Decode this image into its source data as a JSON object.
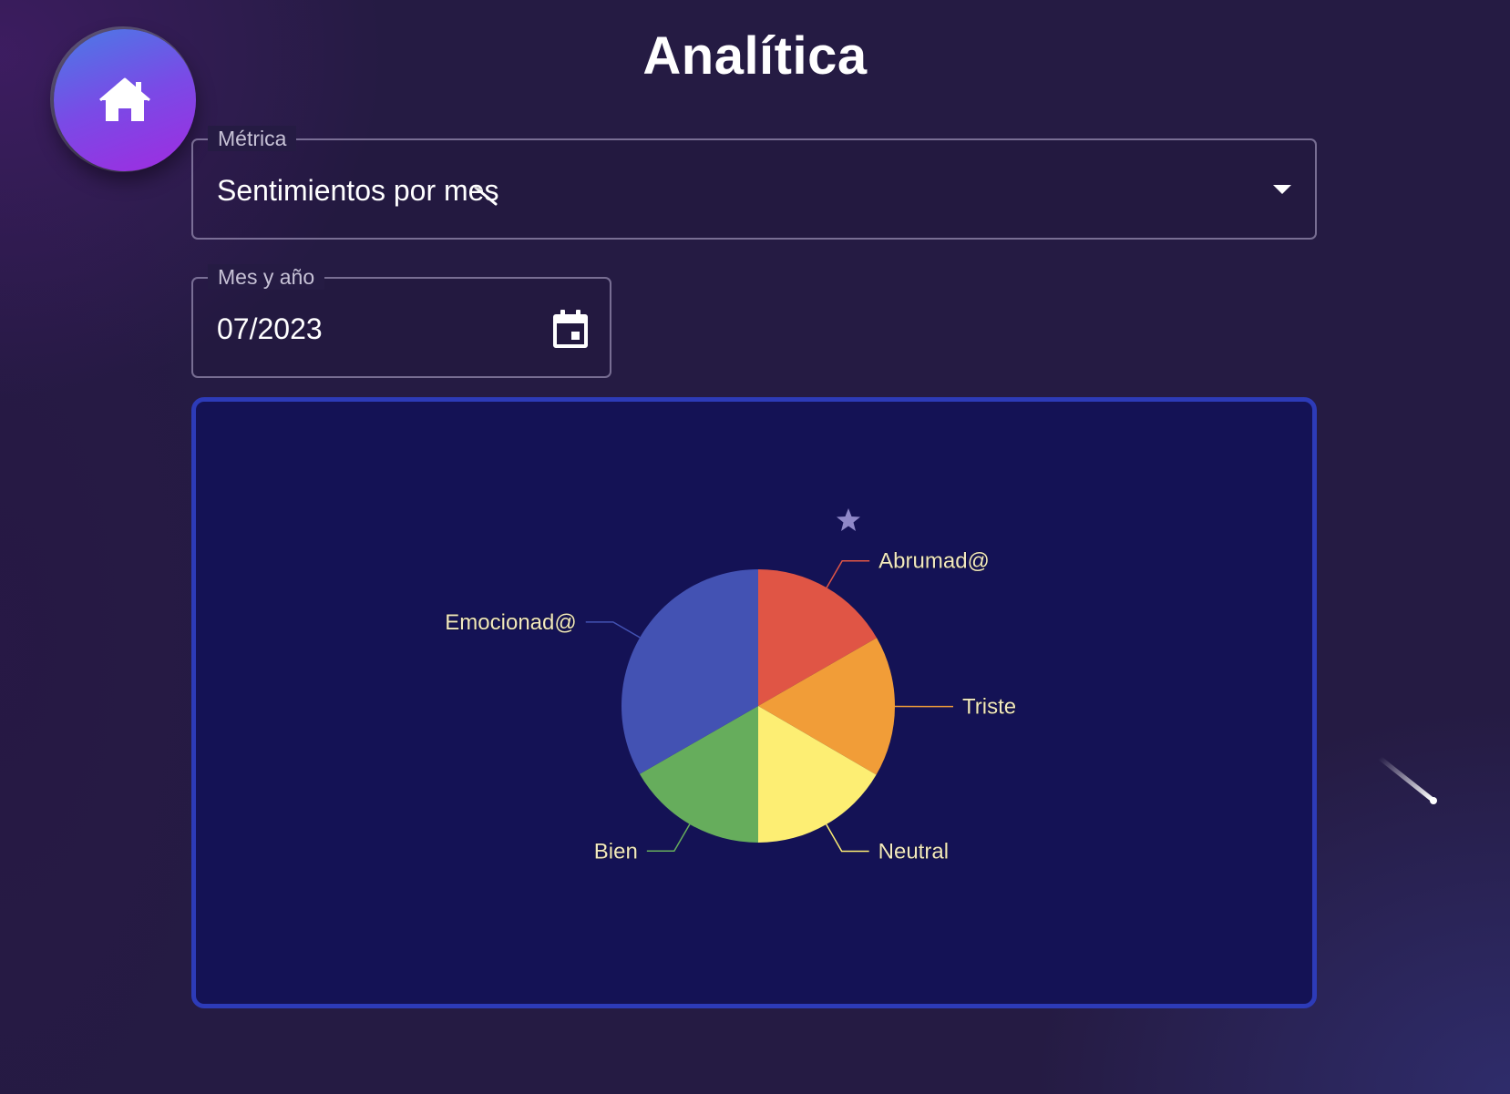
{
  "page": {
    "title": "Analítica"
  },
  "home_button": {
    "icon": "home-icon"
  },
  "metric_select": {
    "label": "Métrica",
    "value": "Sentimientos por mes",
    "icon": "chevron-down-icon"
  },
  "date_field": {
    "label": "Mes y año",
    "value": "07/2023",
    "icon": "calendar-icon"
  },
  "colors": {
    "panel_border": "#2d3bb8",
    "panel_bg": "#141255",
    "fab_gradient_start": "#4a7be6",
    "fab_gradient_end": "#a02be0"
  },
  "chart_data": {
    "type": "pie",
    "title": "",
    "slices": [
      {
        "label": "Abrumad@",
        "value": 16.7,
        "color": "#e05545"
      },
      {
        "label": "Triste",
        "value": 16.7,
        "color": "#f19d38"
      },
      {
        "label": "Neutral",
        "value": 16.6,
        "color": "#fdee73"
      },
      {
        "label": "Bien",
        "value": 16.7,
        "color": "#66ad5c"
      },
      {
        "label": "Emocionad@",
        "value": 33.3,
        "color": "#4352b3"
      }
    ],
    "legend": "none",
    "labels": "outside-with-leader-lines"
  }
}
